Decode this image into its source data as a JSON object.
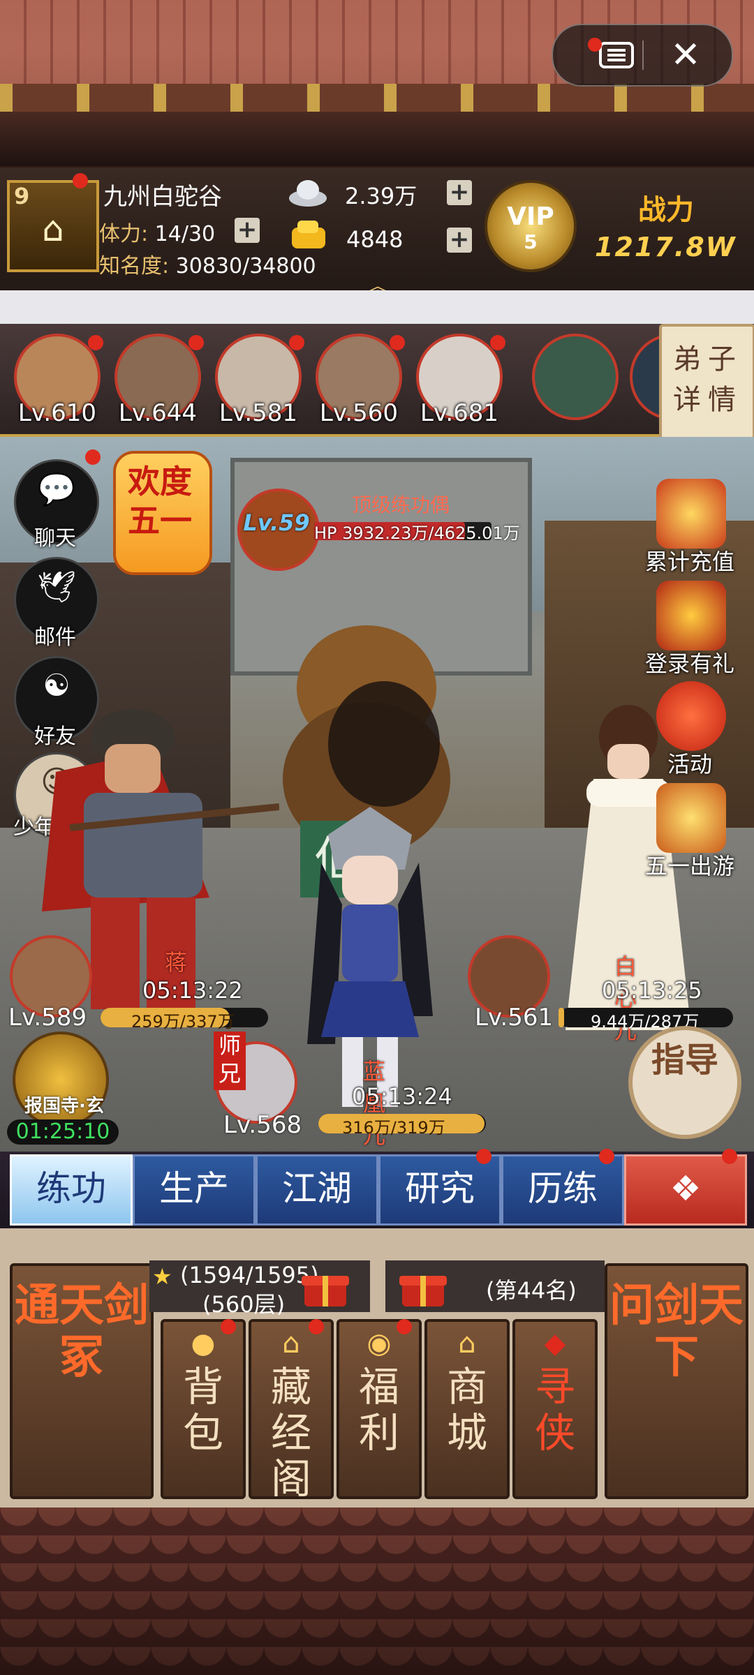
{
  "header": {
    "player_level": "9",
    "player_name": "九州白驼谷",
    "stamina_label": "体力:",
    "stamina_value": "14/30",
    "fame_label": "知名度:",
    "fame_value": "30830/34800",
    "silver": "2.39万",
    "gold": "4848",
    "vip_label": "VIP",
    "vip_level": "5",
    "power_label": "战力",
    "power_value": "1217.8W"
  },
  "heroes": [
    {
      "level": "Lv.610"
    },
    {
      "level": "Lv.644"
    },
    {
      "level": "Lv.581"
    },
    {
      "level": "Lv.560"
    },
    {
      "level": "Lv.681"
    }
  ],
  "disciple_details_label": "弟子详情",
  "left_menu": [
    {
      "label": "聊天",
      "icon": "chat-icon"
    },
    {
      "label": "邮件",
      "icon": "mail-dove-icon"
    },
    {
      "label": "好友",
      "icon": "friends-icon"
    },
    {
      "label": "少年侠客",
      "icon": "young-hero-icon"
    }
  ],
  "event_banner": "欢度五一",
  "boss": {
    "level": "Lv.59",
    "name": "顶级练功偶",
    "hp_text": "HP 3932.23万/4625.01万",
    "hp_fraction": 0.85
  },
  "right_menu": [
    {
      "label": "累计充值",
      "icon": "gift-chest-icon"
    },
    {
      "label": "登录有礼",
      "icon": "treasure-chest-icon"
    },
    {
      "label": "活动",
      "icon": "lantern-icon"
    },
    {
      "label": "五一出游",
      "icon": "travel-gift-icon"
    }
  ],
  "disciples": [
    {
      "name": "蒋",
      "timer": "05:13:22",
      "level": "Lv.589",
      "progress": "259万/337万",
      "progress_fraction": 0.77
    },
    {
      "name": "白心儿",
      "timer": "05:13:25",
      "level": "Lv.561",
      "progress": "9.44万/287万",
      "progress_fraction": 0.03
    },
    {
      "name": "蓝凰儿",
      "timer": "05:13:24",
      "level": "Lv.568",
      "progress": "316万/319万",
      "progress_fraction": 0.99,
      "tag": "师兄"
    }
  ],
  "guide_label": "指导",
  "temple": {
    "label": "报国寺·玄",
    "timer": "01:25:10"
  },
  "tabs": [
    "练功",
    "生产",
    "江湖",
    "研究",
    "历练"
  ],
  "panel": {
    "left_card": "通天剑冢",
    "right_card": "问剑天下",
    "tower_progress": "(1594/1595)",
    "tower_floor": "(560层)",
    "rank": "(第44名)",
    "buttons": [
      {
        "label": "背包",
        "icon": "peach-icon"
      },
      {
        "label": "藏经阁",
        "icon": "pavilion-icon"
      },
      {
        "label": "福利",
        "icon": "coin-icon"
      },
      {
        "label": "商城",
        "icon": "shop-icon"
      },
      {
        "label": "寻侠",
        "icon": "seal-icon"
      }
    ]
  }
}
